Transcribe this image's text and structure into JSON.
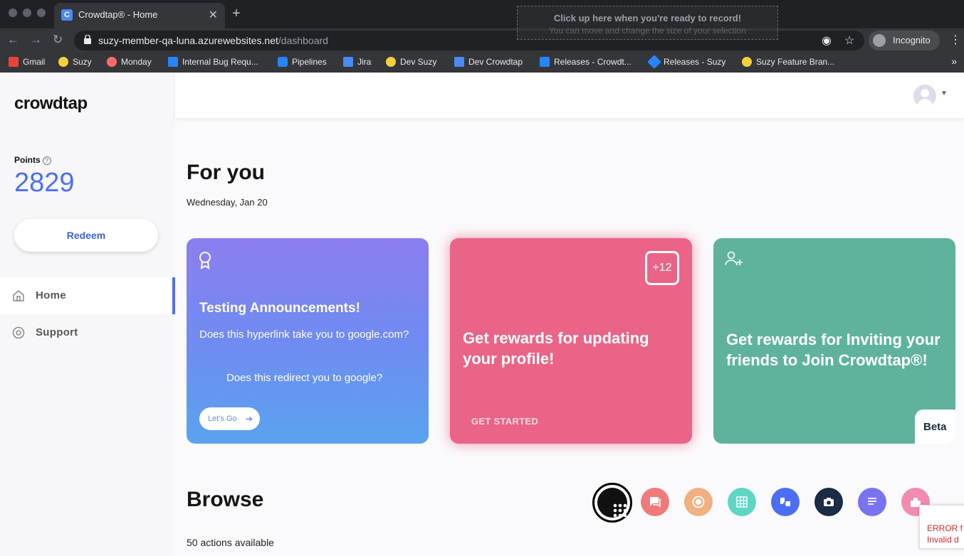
{
  "browser": {
    "tab_title": "Crowdtap® - Home",
    "tab_favicon": "C",
    "url_host": "suzy-member-qa-luna.azurewebsites.net",
    "url_path": "/dashboard",
    "incognito_label": "Incognito",
    "recorder_line1": "Click up here when you're ready to record!",
    "recorder_line2": "You can move and change the size of your selection",
    "bookmarks": [
      {
        "label": "Gmail",
        "icon": "gmail-icon",
        "color": "#ea4335"
      },
      {
        "label": "Suzy",
        "icon": "suzy-icon",
        "color": "#f2d13a"
      },
      {
        "label": "Monday",
        "icon": "monday-icon",
        "color": "#ff6b6b"
      },
      {
        "label": "Internal Bug Requ...",
        "icon": "confluence-icon",
        "color": "#2684ff"
      },
      {
        "label": "Pipelines",
        "icon": "pipelines-icon",
        "color": "#2684ff"
      },
      {
        "label": "Jira",
        "icon": "jira-icon",
        "color": "#4a8af4"
      },
      {
        "label": "Dev Suzy",
        "icon": "suzy-icon",
        "color": "#f2d13a"
      },
      {
        "label": "Dev Crowdtap",
        "icon": "crowdtap-icon",
        "color": "#4a8af4"
      },
      {
        "label": "Releases - Crowdt...",
        "icon": "releases-icon",
        "color": "#2684ff"
      },
      {
        "label": "Releases - Suzy",
        "icon": "releases-icon",
        "color": "#2684ff"
      },
      {
        "label": "Suzy Feature Bran...",
        "icon": "suzy-icon",
        "color": "#f2d13a"
      }
    ]
  },
  "sidebar": {
    "logo": "crowdtap",
    "points_label": "Points",
    "points_value": "2829",
    "redeem_label": "Redeem",
    "nav": [
      {
        "label": "Home",
        "icon": "home-icon",
        "active": true
      },
      {
        "label": "Support",
        "icon": "support-icon",
        "active": false
      }
    ]
  },
  "main": {
    "for_you_title": "For you",
    "date": "Wednesday, Jan 20",
    "cards": [
      {
        "title": "Testing Announcements!",
        "body": "Does this hyperlink take you to google.com?",
        "body2": "Does this redirect you to google?",
        "cta": "Let's Go",
        "color": "#7b8cf2"
      },
      {
        "title": "Get rewards for updating your profile!",
        "badge": "+12",
        "cta": "GET STARTED",
        "color": "#ea6488"
      },
      {
        "title": "Get rewards for Inviting your friends to Join Crowdtap®!",
        "badge": "Beta",
        "color": "#5fb39c"
      }
    ],
    "browse_title": "Browse",
    "actions_available": "50 actions available",
    "categories": [
      {
        "icon": "grid-icon",
        "color": "#111111"
      },
      {
        "icon": "chat-icon",
        "color": "#f07a7a"
      },
      {
        "icon": "record-icon",
        "color": "#f0b082"
      },
      {
        "icon": "table-icon",
        "color": "#5fd6c5"
      },
      {
        "icon": "thumbs-icon",
        "color": "#4c6ef5"
      },
      {
        "icon": "camera-icon",
        "color": "#1b2a45"
      },
      {
        "icon": "text-icon",
        "color": "#7a73f0"
      },
      {
        "icon": "gift-icon",
        "color": "#f28bb0"
      }
    ],
    "error_text": "ERROR f Invalid d"
  }
}
